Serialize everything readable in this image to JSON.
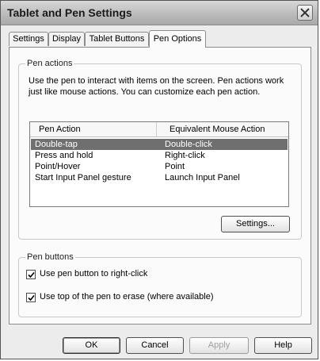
{
  "window": {
    "title": "Tablet and Pen Settings"
  },
  "tabs": [
    {
      "label": "Settings",
      "active": false
    },
    {
      "label": "Display",
      "active": false
    },
    {
      "label": "Tablet Buttons",
      "active": false
    },
    {
      "label": "Pen Options",
      "active": true
    }
  ],
  "pen_actions": {
    "group_title": "Pen actions",
    "description": "Use the pen to interact with items on the screen. Pen actions work just like mouse actions. You can customize each pen action.",
    "columns": [
      "Pen Action",
      "Equivalent Mouse Action"
    ],
    "rows": [
      {
        "action": "Double-tap",
        "mouse": "Double-click",
        "selected": true
      },
      {
        "action": "Press and hold",
        "mouse": "Right-click",
        "selected": false
      },
      {
        "action": "Point/Hover",
        "mouse": "Point",
        "selected": false
      },
      {
        "action": "Start Input Panel gesture",
        "mouse": "Launch Input Panel",
        "selected": false
      }
    ],
    "settings_button": "Settings..."
  },
  "pen_buttons": {
    "group_title": "Pen buttons",
    "options": [
      {
        "label": "Use pen button to right-click",
        "checked": true
      },
      {
        "label": "Use top of the pen to erase (where available)",
        "checked": true
      }
    ]
  },
  "footer": {
    "ok": "OK",
    "cancel": "Cancel",
    "apply": "Apply",
    "help": "Help"
  },
  "icons": {
    "close": "close-icon",
    "check": "checkmark-icon"
  }
}
